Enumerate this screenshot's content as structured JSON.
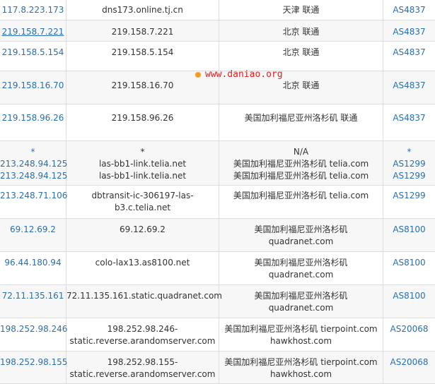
{
  "rows": [
    {
      "ip": [
        "117.8.223.173"
      ],
      "host": [
        "dns173.online.tj.cn"
      ],
      "loc": [
        "天津 联通"
      ],
      "as": [
        "AS4837"
      ]
    },
    {
      "ip": [
        "219.158.7.221"
      ],
      "host": [
        "219.158.7.221"
      ],
      "loc": [
        "北京 联通"
      ],
      "as": [
        "AS4837"
      ]
    },
    {
      "ip": [
        "219.158.5.154"
      ],
      "host": [
        "219.158.5.154"
      ],
      "loc": [
        "北京 联通"
      ],
      "as": [
        "AS4837"
      ]
    },
    {
      "ip": [
        "219.158.16.70"
      ],
      "host": [
        "219.158.16.70"
      ],
      "loc": [
        "北京 联通"
      ],
      "as": [
        "AS4837"
      ]
    },
    {
      "ip": [
        "219.158.96.26"
      ],
      "host": [
        "219.158.96.26"
      ],
      "loc": [
        "美国加利福尼亚州洛杉矶 联通"
      ],
      "as": [
        "AS4837"
      ]
    },
    {
      "ip": [
        "*",
        "213.248.94.125",
        "213.248.94.125"
      ],
      "host": [
        "*",
        "las-bb1-link.telia.net",
        "las-bb1-link.telia.net"
      ],
      "loc": [
        "N/A",
        "美国加利福尼亚州洛杉矶 telia.com",
        "美国加利福尼亚州洛杉矶 telia.com"
      ],
      "as": [
        "*",
        "AS1299",
        "AS1299"
      ]
    },
    {
      "ip": [
        "213.248.71.106"
      ],
      "host": [
        "dbtransit-ic-306197-las-",
        "b3.c.telia.net"
      ],
      "loc": [
        "美国加利福尼亚州洛杉矶 telia.com"
      ],
      "as": [
        "AS1299"
      ]
    },
    {
      "ip": [
        "69.12.69.2"
      ],
      "host": [
        "69.12.69.2"
      ],
      "loc": [
        "美国加利福尼亚州洛杉矶",
        "quadranet.com"
      ],
      "as": [
        "AS8100"
      ]
    },
    {
      "ip": [
        "96.44.180.94"
      ],
      "host": [
        "colo-lax13.as8100.net"
      ],
      "loc": [
        "美国加利福尼亚州洛杉矶",
        "quadranet.com"
      ],
      "as": [
        "AS8100"
      ]
    },
    {
      "ip": [
        "72.11.135.161"
      ],
      "host": [
        "72.11.135.161.static.quadranet.com"
      ],
      "loc": [
        "美国加利福尼亚州洛杉矶",
        "quadranet.com"
      ],
      "as": [
        "AS8100"
      ]
    },
    {
      "ip": [
        "198.252.98.246"
      ],
      "host": [
        "198.252.98.246-",
        "static.reverse.arandomserver.com"
      ],
      "loc": [
        "美国加利福尼亚州洛杉矶 tierpoint.com",
        "hawkhost.com"
      ],
      "as": [
        "AS20068"
      ]
    },
    {
      "ip": [
        "198.252.98.155"
      ],
      "host": [
        "198.252.98.155-",
        "static.reverse.arandomserver.com"
      ],
      "loc": [
        "美国加利福尼亚州洛杉矶 tierpoint.com",
        "hawkhost.com"
      ],
      "as": [
        "AS20068"
      ]
    }
  ],
  "watermark": "www.daniao.org",
  "colors": {
    "link": "#2a6fb0",
    "watermark": "#dd2222",
    "border": "#dddddd",
    "alt_row": "#f7f7f7"
  },
  "icons": {
    "watermark_dot": "dot-icon"
  }
}
